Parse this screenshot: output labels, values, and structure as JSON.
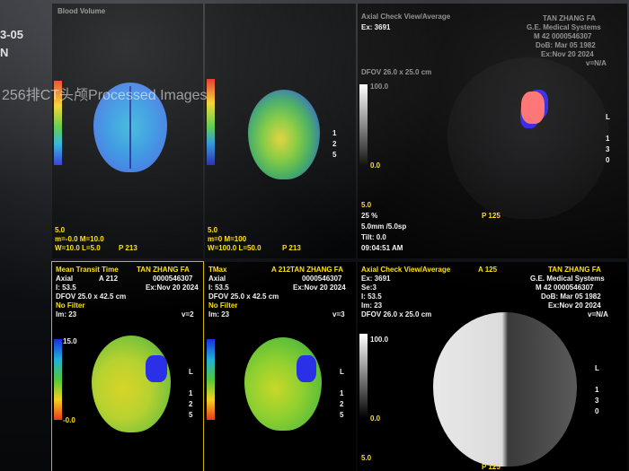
{
  "left_edge": {
    "date_frag": "3-05",
    "letter": "N"
  },
  "ghost_title": "256排CT头颅Processed Images",
  "top_left": {
    "header_blur": "Blood Volume",
    "bottom_label": "5.0",
    "line1": "m=-0.0 M=10.0",
    "line2": "W=10.0 L=5.0",
    "p_label": "P 213"
  },
  "top_mid": {
    "bottom_label": "5.0",
    "line1": "m=0 M=100",
    "line2": "W=100.0 L=50.0",
    "p_label": "P 213",
    "side_marks": [
      "1",
      "2",
      "5"
    ]
  },
  "top_right": {
    "header_blur": "Axial Check View/Average",
    "right_block": [
      "TAN ZHANG FA",
      "G.E. Medical Systems",
      "M 42 0000546307",
      "DoB: Mar 05 1982",
      "Ex:Nov 20 2024",
      "v=N/A"
    ],
    "ex_line": "Ex: 3691",
    "dfov_blur": "DFOV 26.0 x 25.0 cm",
    "scale_top": "100.0",
    "scale_bottom": "0.0",
    "lower_lines": [
      "5.0",
      "25 %",
      "5.0mm /5.0sp",
      "Tilt: 0.0",
      "09:04:51 AM"
    ],
    "p_label": "P 125",
    "side_marks": [
      "L",
      "1",
      "3",
      "0"
    ]
  },
  "bottom_left": {
    "title": "Mean Transit Time",
    "series": "A 212",
    "patient": "TAN ZHANG FA",
    "axial": "Axial",
    "id": "0000546307",
    "loc": "I: 53.5",
    "exam": "Ex:Nov 20 2024",
    "dfov": "DFOV 25.0 x 42.5 cm",
    "filter": "No Filter",
    "im": "Im: 23",
    "v": "v=2",
    "scale_top": "15.0",
    "scale_bottom": "-0.0",
    "side_marks": [
      "L",
      "1",
      "2",
      "5"
    ]
  },
  "bottom_mid": {
    "title": "TMax",
    "series_patient": "A 212TAN ZHANG FA",
    "axial": "Axial",
    "id": "0000546307",
    "loc": "I: 53.5",
    "exam": "Ex:Nov 20 2024",
    "dfov": "DFOV 25.0 x 42.5 cm",
    "filter": "No Filter",
    "im": "Im: 23",
    "v": "v=3",
    "side_marks": [
      "L",
      "1",
      "2",
      "5"
    ]
  },
  "bottom_right": {
    "title": "Axial Check View/Average",
    "series": "A 125",
    "patient": "TAN ZHANG FA",
    "ex": "Ex: 3691",
    "vendor": "G.E. Medical Systems",
    "se": "Se:3",
    "mid": "M 42 0000546307",
    "loc": "I: 53.5",
    "dob": "DoB: Mar 05 1982",
    "im": "Im: 23",
    "exam": "Ex:Nov 20 2024",
    "dfov": "DFOV 26.0 x 25.0 cm",
    "v": "v=N/A",
    "scale_top": "100.0",
    "scale_bottom": "0.0",
    "bottom_label": "5.0",
    "p_label": "P 125",
    "side_marks": [
      "L",
      "1",
      "3",
      "0"
    ]
  }
}
